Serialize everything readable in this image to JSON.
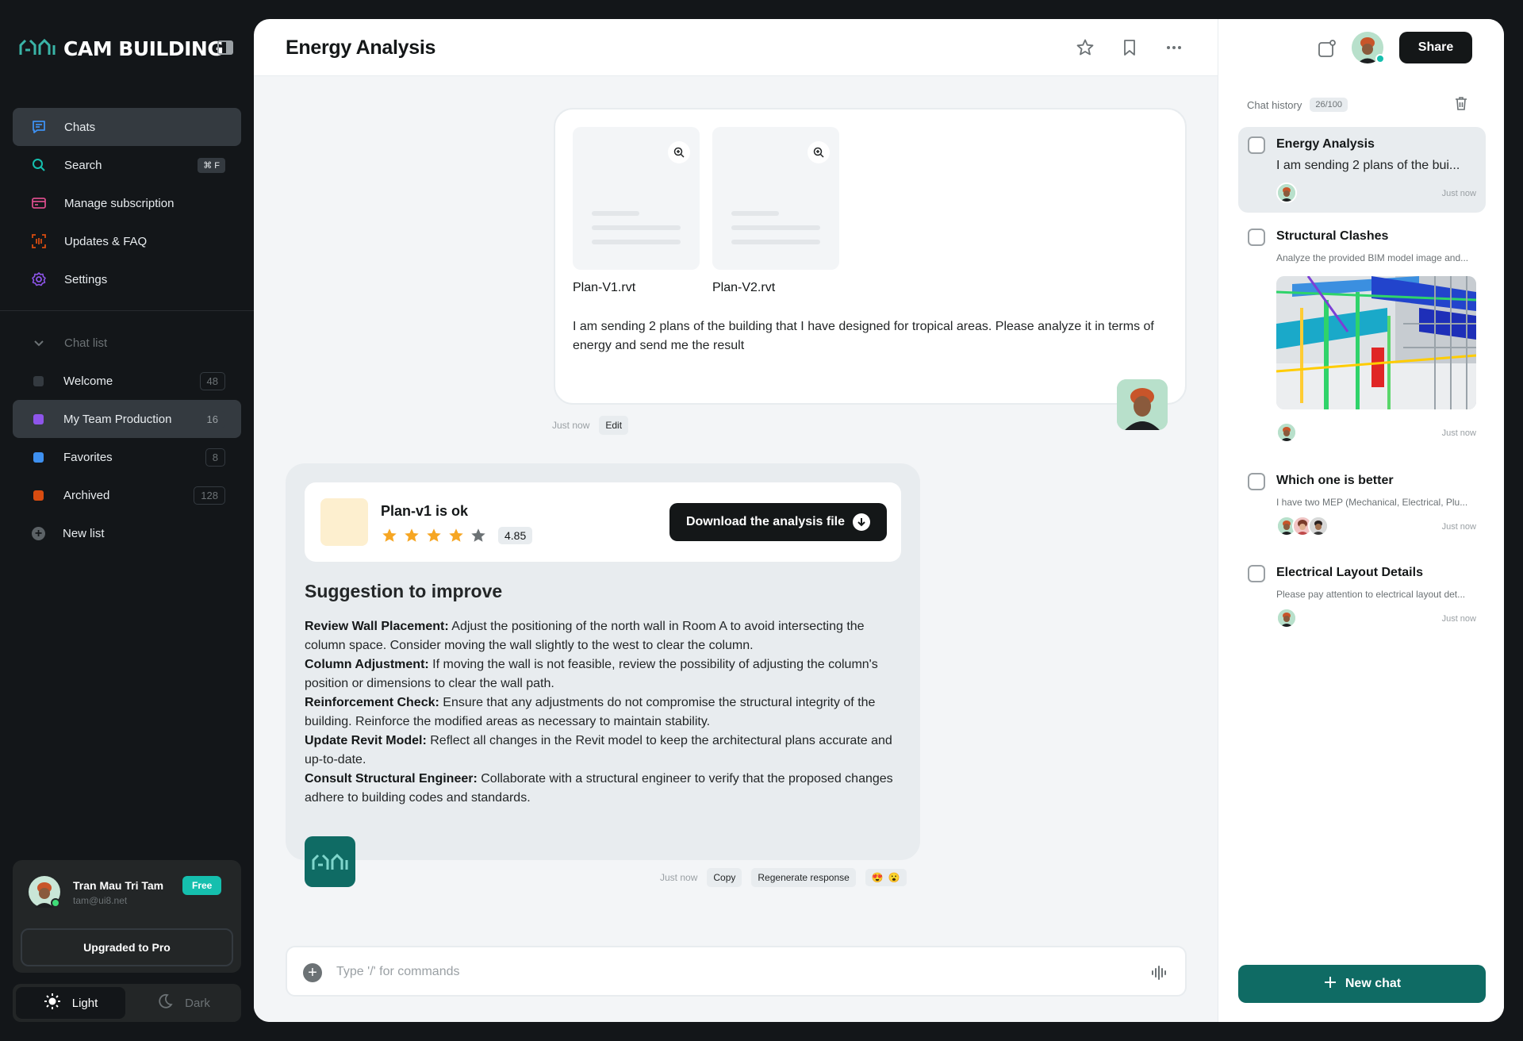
{
  "brand": {
    "name": "CAM BUILDING"
  },
  "nav": [
    {
      "label": "Chats",
      "icon": "chat-icon",
      "active": true
    },
    {
      "label": "Search",
      "icon": "search-icon",
      "shortcut": "⌘ F"
    },
    {
      "label": "Manage subscription",
      "icon": "card-icon"
    },
    {
      "label": "Updates & FAQ",
      "icon": "scan-icon"
    },
    {
      "label": "Settings",
      "icon": "gear-icon"
    }
  ],
  "chat_list": {
    "heading": "Chat list",
    "items": [
      {
        "label": "Welcome",
        "count": "48",
        "color": "#343a40"
      },
      {
        "label": "My Team Production",
        "count": "16",
        "color": "#8e55ea",
        "active": true
      },
      {
        "label": "Favorites",
        "count": "8",
        "color": "#3e90f0"
      },
      {
        "label": "Archived",
        "count": "128",
        "color": "#d84c10"
      }
    ],
    "new_list": "New list"
  },
  "user": {
    "name": "Tran Mau Tri Tam",
    "email": "tam@ui8.net",
    "plan": "Free",
    "upgrade": "Upgraded to Pro"
  },
  "theme": {
    "light": "Light",
    "dark": "Dark"
  },
  "header": {
    "title": "Energy Analysis"
  },
  "user_message": {
    "files": [
      "Plan-V1.rvt",
      "Plan-V2.rvt"
    ],
    "text": "I am sending 2 plans of the building that I have designed for tropical areas. Please analyze it in terms of energy and send me the result",
    "time": "Just now",
    "edit": "Edit"
  },
  "ai_message": {
    "card_title": "Plan-v1 is ok",
    "rating": "4.85",
    "stars": 4,
    "download": "Download the analysis file",
    "heading": "Suggestion to improve",
    "points": [
      {
        "title": "Review Wall Placement:",
        "text": " Adjust the positioning of the north wall in Room A to avoid intersecting the column space. Consider moving the wall slightly to the west to clear the column."
      },
      {
        "title": "Column Adjustment:",
        "text": " If moving the wall is not feasible, review the possibility of adjusting the column's position or dimensions to clear the wall path."
      },
      {
        "title": "Reinforcement Check:",
        "text": " Ensure that any adjustments do not compromise the structural integrity of the building. Reinforce the modified areas as necessary to maintain stability."
      },
      {
        "title": "Update Revit Model:",
        "text": " Reflect all changes in the Revit model to keep the architectural plans accurate and up-to-date."
      },
      {
        "title": "Consult Structural Engineer:",
        "text": " Collaborate with a structural engineer to verify that the proposed changes adhere to building codes and standards."
      }
    ],
    "time": "Just now",
    "copy": "Copy",
    "regenerate": "Regenerate response",
    "reactions": [
      "😍",
      "😮"
    ]
  },
  "composer": {
    "placeholder": "Type '/' for commands"
  },
  "right_panel": {
    "share": "Share",
    "history_label": "Chat history",
    "history_count": "26/100",
    "items": [
      {
        "title": "Energy Analysis",
        "sub": "I am sending 2 plans of the bui...",
        "time": "Just now"
      },
      {
        "title": "Structural Clashes",
        "sub": "Analyze the provided BIM model image and...",
        "time": "Just now"
      },
      {
        "title": "Which one is better",
        "sub": "I have two MEP (Mechanical, Electrical, Plu...",
        "time": "Just now"
      },
      {
        "title": "Electrical Layout Details",
        "sub": "Please pay attention to electrical layout det...",
        "time": "Just now"
      }
    ],
    "new_chat": "New chat"
  },
  "colors": {
    "accent": "#0f6b64",
    "badge": "#15bfae",
    "star": "#f6a623"
  }
}
